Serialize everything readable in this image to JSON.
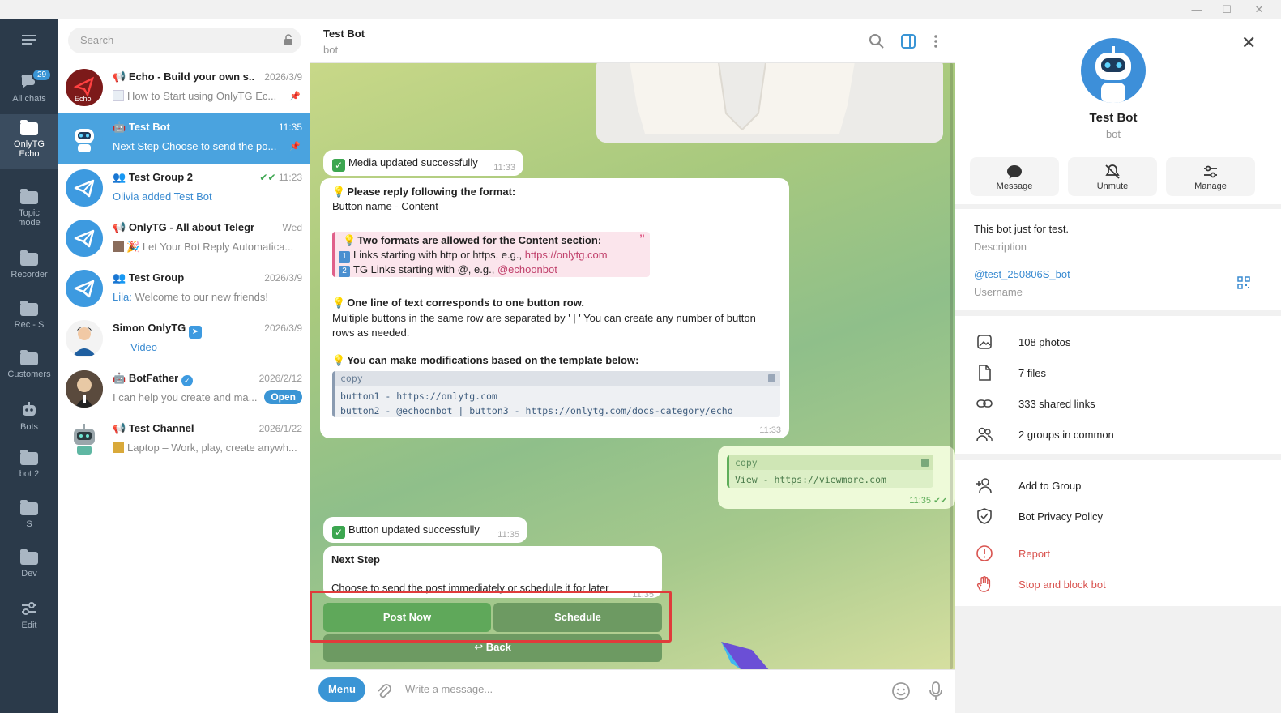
{
  "rail": {
    "badge": "29",
    "items": [
      {
        "label": "All chats"
      },
      {
        "label": "OnlyTG Echo"
      },
      {
        "label": "Topic mode"
      },
      {
        "label": "Recorder"
      },
      {
        "label": "Rec - S"
      },
      {
        "label": "Customers"
      },
      {
        "label": "Bots"
      },
      {
        "label": "bot 2"
      },
      {
        "label": "S"
      },
      {
        "label": "Dev"
      },
      {
        "label": "Edit"
      }
    ]
  },
  "search": {
    "placeholder": "Search"
  },
  "chats": [
    {
      "name": "Echo - Build your own s...",
      "time": "2026/3/9",
      "preview": "How to Start using OnlyTG Ec..."
    },
    {
      "name": "Test Bot",
      "time": "11:35",
      "preview": "Next Step  Choose to send the po..."
    },
    {
      "name": "Test Group 2",
      "time": "11:23",
      "preview": "Olivia added Test Bot"
    },
    {
      "name": "OnlyTG - All about Telegram",
      "time": "Wed",
      "preview": "Let Your Bot Reply Automatica..."
    },
    {
      "name": "Test Group",
      "time": "2026/3/9",
      "preview_sender": "Lila:",
      "preview": "Welcome to our new friends!"
    },
    {
      "name": "Simon OnlyTG",
      "time": "2026/3/9",
      "preview": "Video"
    },
    {
      "name": "BotFather",
      "time": "2026/2/12",
      "preview": "I can help you create and ma...",
      "action": "Open"
    },
    {
      "name": "Test Channel",
      "time": "2026/1/22",
      "preview": "Laptop – Work, play, create anywh..."
    }
  ],
  "header": {
    "title": "Test Bot",
    "subtitle": "bot"
  },
  "messages": {
    "media_updated": {
      "text": "Media updated successfully",
      "time": "11:33"
    },
    "format": {
      "line1": "Please reply following the format:",
      "line2": "Button name - Content",
      "quote_title": "Two formats are allowed for the Content section:",
      "quote_1_pre": "Links starting with http or https, e.g., ",
      "quote_1_link": "https://onlytg.com",
      "quote_2_pre": "TG Links starting with @, e.g., ",
      "quote_2_link": "@echoonbot",
      "row_title": "One line of text corresponds to one button row.",
      "row_body": "Multiple buttons in the same row are separated by ' | '  You can create any number of button rows as needed.",
      "tmpl_title": "You can make modifications based on the template below:",
      "code_hdr": "copy",
      "code_1": "button1 - https://onlytg.com",
      "code_2": "button2 - @echoonbot | button3 - https://onlytg.com/docs-category/echo",
      "time": "11:33"
    },
    "outgoing": {
      "code_hdr": "copy",
      "code": "View - https://viewmore.com",
      "time": "11:35"
    },
    "button_updated": {
      "text": "Button updated successfully",
      "time": "11:35"
    },
    "next_step": {
      "title": "Next Step",
      "body": "Choose to send the post immediately or schedule it for later",
      "time": "11:35"
    }
  },
  "keyboard": {
    "post_now": "Post Now",
    "schedule": "Schedule",
    "back": "Back"
  },
  "compose": {
    "menu": "Menu",
    "placeholder": "Write a message..."
  },
  "profile": {
    "name": "Test Bot",
    "subtitle": "bot",
    "actions": {
      "message": "Message",
      "unmute": "Unmute",
      "manage": "Manage"
    },
    "about": "This bot just for test.",
    "about_label": "Description",
    "username": "@test_250806S_bot",
    "username_label": "Username",
    "media": {
      "photos": "108 photos",
      "files": "7 files",
      "links": "333 shared links",
      "groups": "2 groups in common"
    },
    "add_group": "Add to Group",
    "privacy": "Bot Privacy Policy",
    "report": "Report",
    "block": "Stop and block bot"
  },
  "colors": {
    "accent": "#3a95d5",
    "selected": "#4aa3df",
    "rail": "#2b3a4a",
    "kb_green": "#5fa85a",
    "highlight": "#e03b3b",
    "danger": "#d9534f"
  }
}
